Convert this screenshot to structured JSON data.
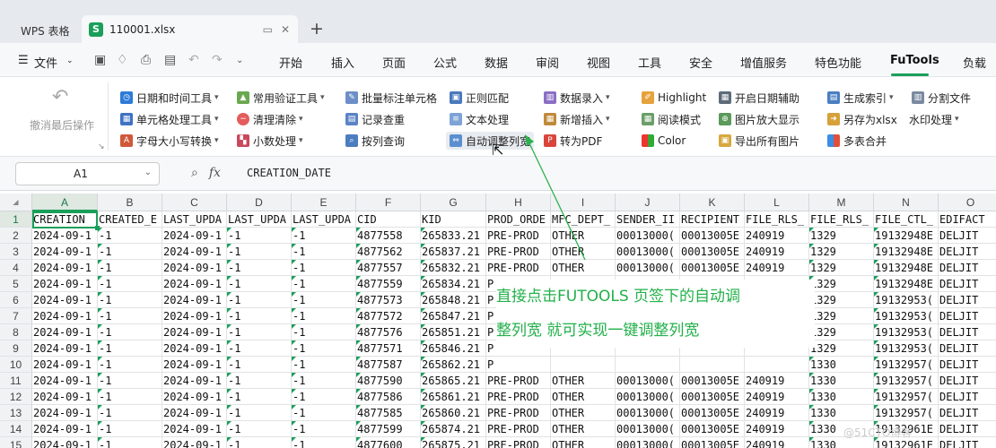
{
  "tabs": {
    "home": "WPS 表格",
    "file": "110001.xlsx"
  },
  "menu": [
    "文件",
    "开始",
    "插入",
    "页面",
    "公式",
    "数据",
    "审阅",
    "视图",
    "工具",
    "安全",
    "增值服务",
    "特色功能",
    "FuTools",
    "负载"
  ],
  "ribbon": {
    "undo": "撤消最后操作",
    "col1": [
      "日期和时间工具",
      "单元格处理工具",
      "字母大小写转换"
    ],
    "col2": [
      "常用验证工具",
      "清理清除",
      "小数处理"
    ],
    "col3": [
      "批量标注单元格",
      "记录查重",
      "按列查询"
    ],
    "col4": [
      "正则匹配",
      "文本处理",
      "自动调整列宽"
    ],
    "col5": [
      "数据录入",
      "新增插入",
      "转为PDF"
    ],
    "col6": [
      "Highlight",
      "阅读模式",
      "Color"
    ],
    "col7": [
      "开启日期辅助",
      "图片放大显示",
      "导出所有图片"
    ],
    "col8": [
      "生成索引",
      "另存为xlsx",
      "多表合并"
    ],
    "col9": [
      "分割文件",
      "水印处理"
    ]
  },
  "formula_bar": {
    "name_box": "A1",
    "formula": "CREATION_DATE"
  },
  "columns": [
    "A",
    "B",
    "C",
    "D",
    "E",
    "F",
    "G",
    "H",
    "I",
    "J",
    "K",
    "L",
    "M",
    "N",
    "O"
  ],
  "rows": [
    [
      "CREATION",
      "CREATED_E",
      "LAST_UPDA",
      "LAST_UPDA",
      "LAST_UPDA",
      "CID",
      "KID",
      "PROD_ORDE",
      "MFC_DEPT_",
      "SENDER_II",
      "RECIPIENT",
      "FILE_RLS_",
      "FILE_RLS_",
      "FILE_CTL_",
      "EDIFACT"
    ],
    [
      "2024-09-1",
      "-1",
      "2024-09-1",
      "-1",
      "-1",
      "4877558",
      "265833.21",
      "PRE-PROD",
      "OTHER",
      "00013000(",
      "00013005E",
      "240919",
      "1329",
      "19132948E",
      "DELJIT"
    ],
    [
      "2024-09-1",
      "-1",
      "2024-09-1",
      "-1",
      "-1",
      "4877562",
      "265837.21",
      "PRE-PROD",
      "OTHER",
      "00013000(",
      "00013005E",
      "240919",
      "1329",
      "19132948E",
      "DELJIT"
    ],
    [
      "2024-09-1",
      "-1",
      "2024-09-1",
      "-1",
      "-1",
      "4877557",
      "265832.21",
      "PRE-PROD",
      "OTHER",
      "00013000(",
      "00013005E",
      "240919",
      "1329",
      "19132948E",
      "DELJIT"
    ],
    [
      "2024-09-1",
      "-1",
      "2024-09-1",
      "-1",
      "-1",
      "4877559",
      "265834.21",
      "P",
      "",
      "",
      "",
      "",
      "1329",
      "19132948E",
      "DELJIT"
    ],
    [
      "2024-09-1",
      "-1",
      "2024-09-1",
      "-1",
      "-1",
      "4877573",
      "265848.21",
      "P",
      "",
      "",
      "",
      "",
      "1329",
      "19132953(",
      "DELJIT"
    ],
    [
      "2024-09-1",
      "-1",
      "2024-09-1",
      "-1",
      "-1",
      "4877572",
      "265847.21",
      "P",
      "",
      "",
      "",
      "",
      "1329",
      "19132953(",
      "DELJIT"
    ],
    [
      "2024-09-1",
      "-1",
      "2024-09-1",
      "-1",
      "-1",
      "4877576",
      "265851.21",
      "P",
      "",
      "",
      "",
      "",
      "1329",
      "19132953(",
      "DELJIT"
    ],
    [
      "2024-09-1",
      "-1",
      "2024-09-1",
      "-1",
      "-1",
      "4877571",
      "265846.21",
      "P",
      "",
      "",
      "",
      "",
      "1329",
      "19132953(",
      "DELJIT"
    ],
    [
      "2024-09-1",
      "-1",
      "2024-09-1",
      "-1",
      "-1",
      "4877587",
      "265862.21",
      "P",
      "",
      "",
      "",
      "",
      "1330",
      "19132957(",
      "DELJIT"
    ],
    [
      "2024-09-1",
      "-1",
      "2024-09-1",
      "-1",
      "-1",
      "4877590",
      "265865.21",
      "PRE-PROD",
      "OTHER",
      "00013000(",
      "00013005E",
      "240919",
      "1330",
      "19132957(",
      "DELJIT"
    ],
    [
      "2024-09-1",
      "-1",
      "2024-09-1",
      "-1",
      "-1",
      "4877586",
      "265861.21",
      "PRE-PROD",
      "OTHER",
      "00013000(",
      "00013005E",
      "240919",
      "1330",
      "19132957(",
      "DELJIT"
    ],
    [
      "2024-09-1",
      "-1",
      "2024-09-1",
      "-1",
      "-1",
      "4877585",
      "265860.21",
      "PRE-PROD",
      "OTHER",
      "00013000(",
      "00013005E",
      "240919",
      "1330",
      "19132957(",
      "DELJIT"
    ],
    [
      "2024-09-1",
      "-1",
      "2024-09-1",
      "-1",
      "-1",
      "4877599",
      "265874.21",
      "PRE-PROD",
      "OTHER",
      "00013000(",
      "00013005E",
      "240919",
      "1330",
      "19132961E",
      "DELJIT"
    ],
    [
      "2024-09-1",
      "-1",
      "2024-09-1",
      "-1",
      "-1",
      "4877600",
      "265875.21",
      "PRE-PROD",
      "OTHER",
      "00013000(",
      "00013005E",
      "240919",
      "1330",
      "19132961E",
      "DELJIT"
    ]
  ],
  "annotation": {
    "line1": "直接点击FUTOOLS 页签下的自动调",
    "line2": "整列宽 就可实现一键调整列宽"
  },
  "watermark": "@51CTO博客",
  "colors": {
    "accent": "#1a9f5a",
    "annotation": "#22b04a"
  }
}
